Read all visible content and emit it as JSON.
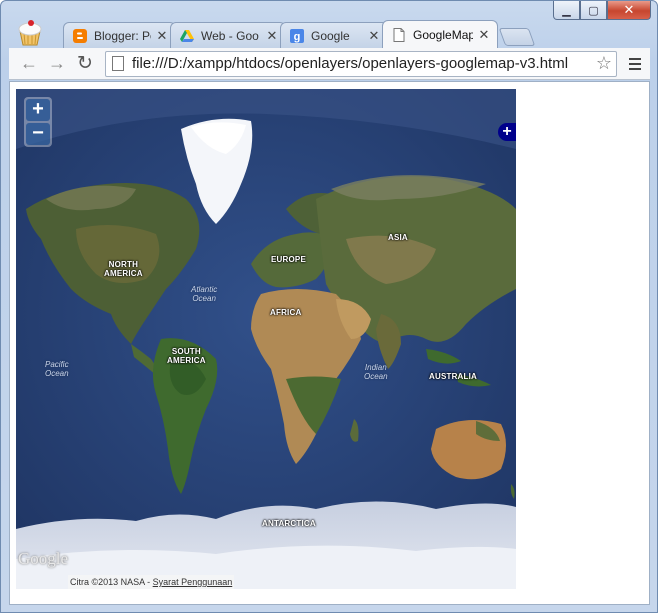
{
  "browser": {
    "tabs": [
      {
        "title": "Blogger: Pe",
        "icon": "blogger-icon",
        "color": "#f57d00"
      },
      {
        "title": "Web - Goo",
        "icon": "drive-icon",
        "color": "#1da462"
      },
      {
        "title": "Google",
        "icon": "google-icon",
        "color": "#4a86e8"
      },
      {
        "title": "GoogleMap",
        "icon": "page-icon",
        "color": "#888888"
      }
    ],
    "close_glyph": "✕",
    "url": "file:///D:/xampp/htdocs/openlayers/openlayers-googlemap-v3.html",
    "star": "☆"
  },
  "map": {
    "zoom_in": "+",
    "zoom_out": "−",
    "layer_switcher": "+",
    "continents": [
      {
        "name": "NORTH\nAMERICA"
      },
      {
        "name": "EUROPE"
      },
      {
        "name": "ASIA"
      },
      {
        "name": "AFRICA"
      },
      {
        "name": "SOUTH\nAMERICA"
      },
      {
        "name": "AUSTRALIA"
      },
      {
        "name": "ANTARCTICA"
      }
    ],
    "oceans": [
      {
        "name": "Atlantic\nOcean"
      },
      {
        "name": "Pacific\nOcean"
      },
      {
        "name": "Indian\nOcean"
      }
    ],
    "google_logo": "Google",
    "attribution_text": "Citra ©2013 NASA - ",
    "attribution_link": "Syarat Penggunaan"
  },
  "colors": {
    "ocean": "#2b4576",
    "land": "#5b6b3a",
    "desert": "#b08a55",
    "ice": "#e8ecf3"
  }
}
